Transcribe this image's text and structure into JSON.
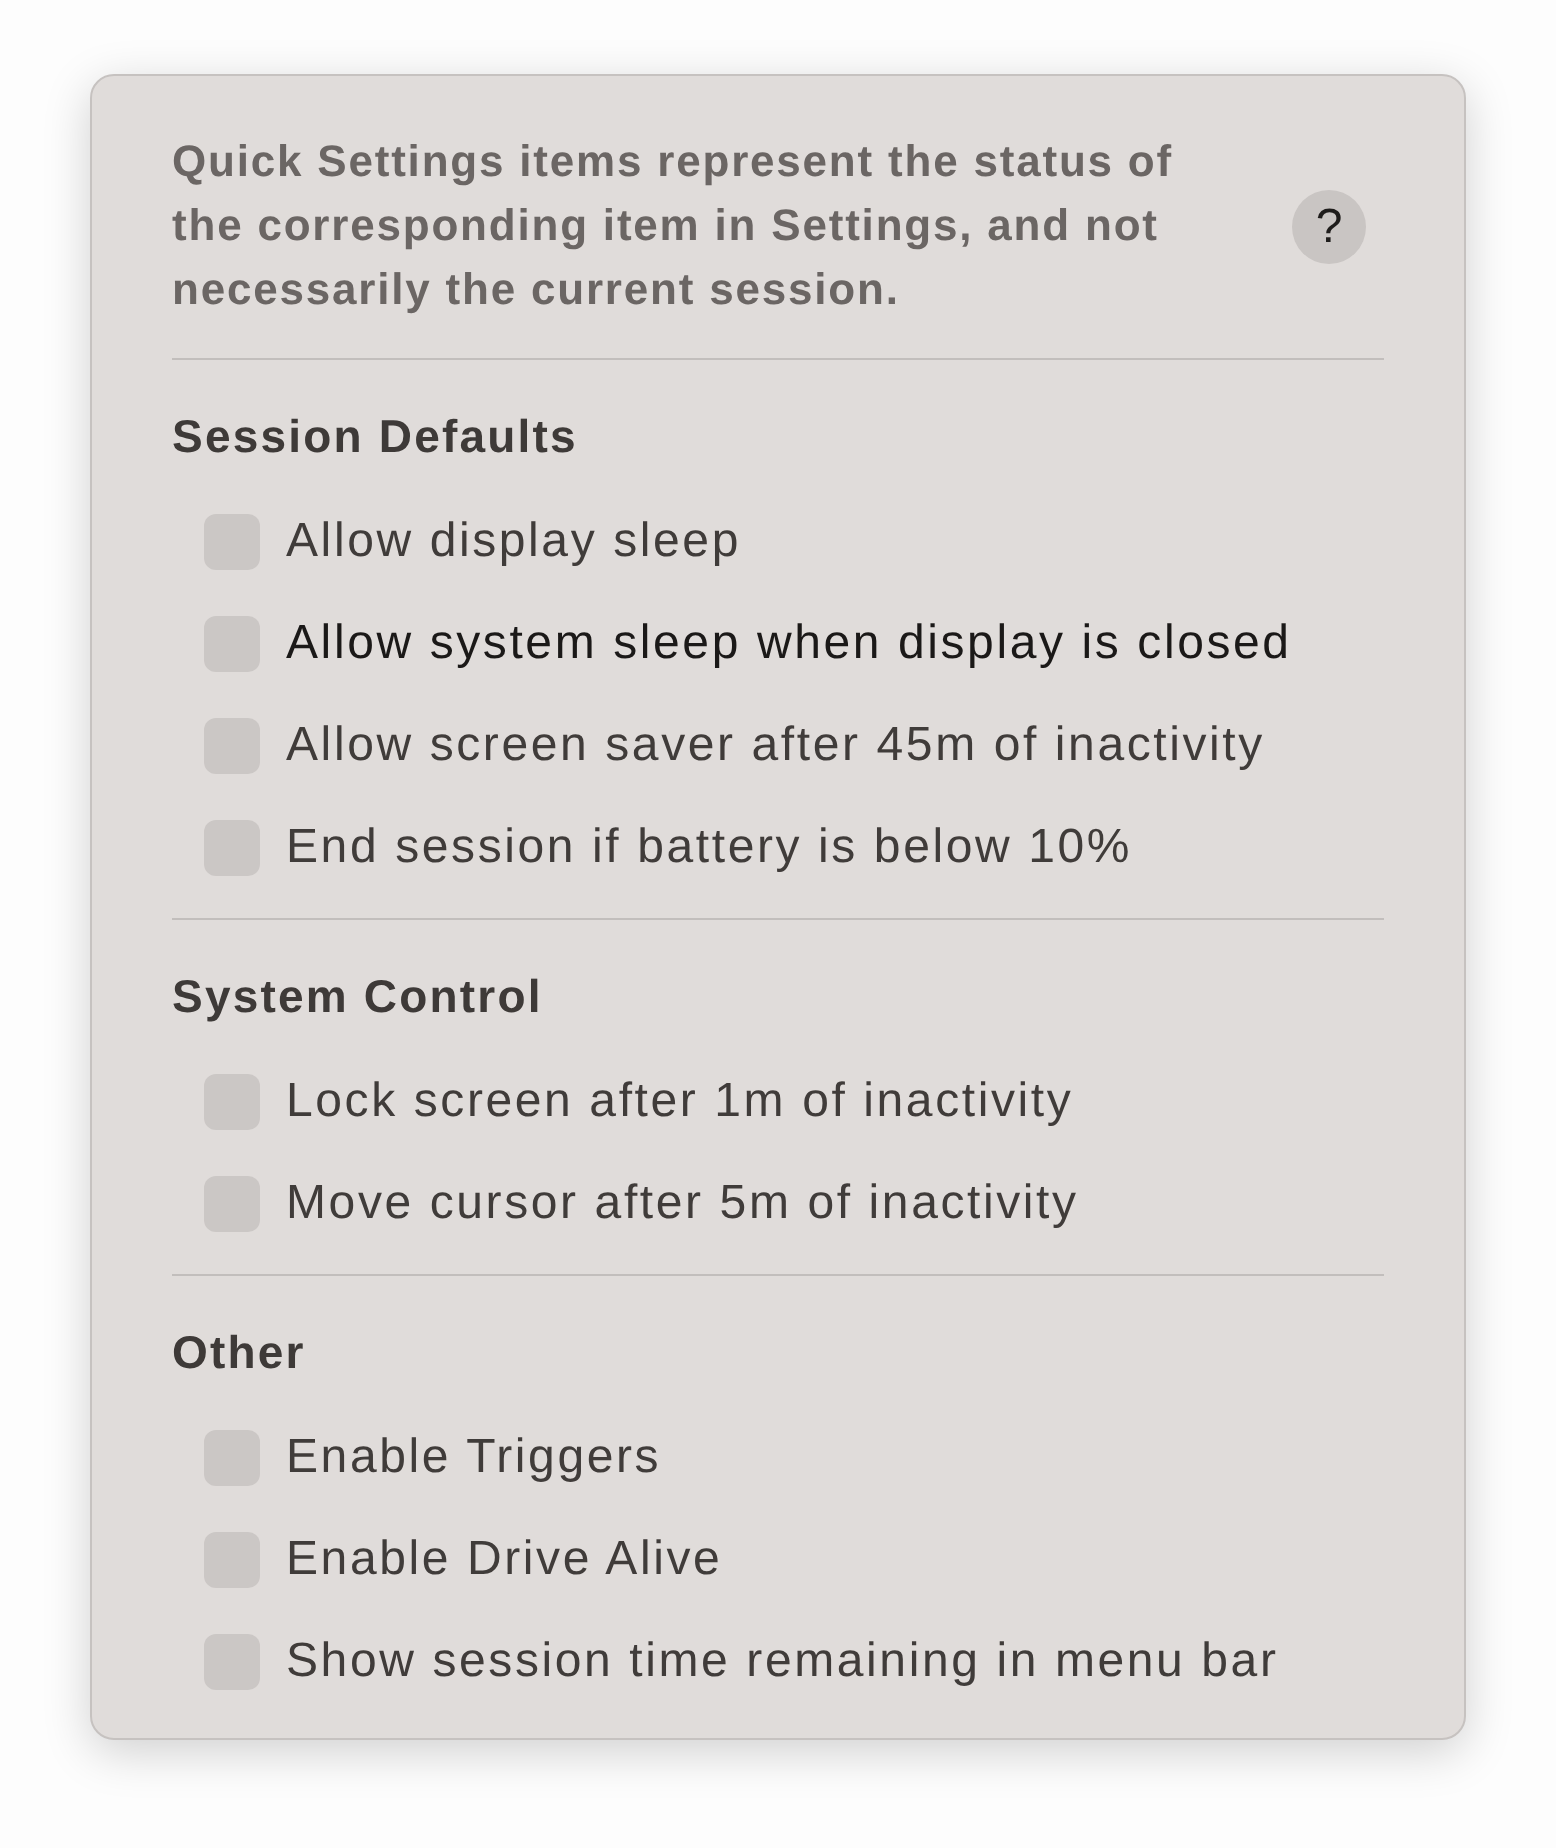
{
  "intro": {
    "text": "Quick Settings items represent the status of the corresponding item in Settings, and not necessarily the current session.",
    "help_button": "?"
  },
  "sections": [
    {
      "heading": "Session Defaults",
      "options": [
        {
          "label": "Allow display sleep",
          "checked": false,
          "highlighted": false
        },
        {
          "label": "Allow system sleep when display is closed",
          "checked": false,
          "highlighted": true
        },
        {
          "label": "Allow screen saver after 45m of inactivity",
          "checked": false,
          "highlighted": false
        },
        {
          "label": "End session if battery is below 10%",
          "checked": false,
          "highlighted": false
        }
      ]
    },
    {
      "heading": "System Control",
      "options": [
        {
          "label": "Lock screen after 1m of inactivity",
          "checked": false,
          "highlighted": false
        },
        {
          "label": "Move cursor after 5m of inactivity",
          "checked": false,
          "highlighted": false
        }
      ]
    },
    {
      "heading": "Other",
      "options": [
        {
          "label": "Enable Triggers",
          "checked": false,
          "highlighted": false
        },
        {
          "label": "Enable Drive Alive",
          "checked": false,
          "highlighted": false
        },
        {
          "label": "Show session time remaining in menu bar",
          "checked": false,
          "highlighted": false
        }
      ]
    }
  ]
}
